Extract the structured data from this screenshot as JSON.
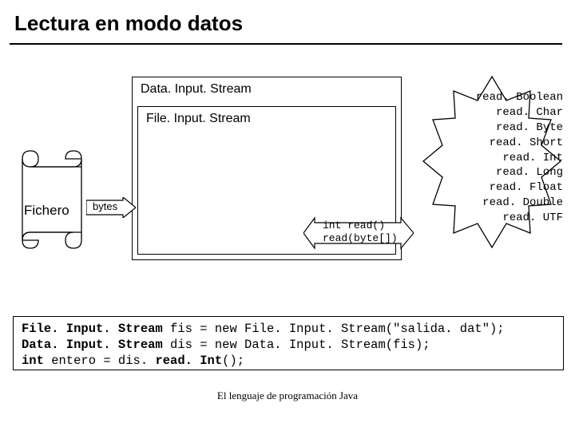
{
  "title": "Lectura en modo datos",
  "diagram": {
    "outer_box_label": "Data. Input. Stream",
    "inner_box_label": "File. Input. Stream",
    "fichero_label": "Fichero",
    "bytes_label": "bytes",
    "read_methods_line1": "int read()",
    "read_methods_line2": "read(byte[])"
  },
  "methods_list": [
    "read. Boolean",
    "read. Char",
    "read. Byte",
    "read. Short",
    "read. Int",
    "read. Long",
    "read. Float",
    "read. Double",
    "read. UTF"
  ],
  "code": {
    "line1_type": "File. Input. Stream",
    "line1_rest": " fis = new File. Input. Stream(\"salida. dat\");",
    "line2_type": "Data. Input. Stream",
    "line2_rest": " dis = new Data. Input. Stream(fis);",
    "line3_type": "int",
    "line3_mid": " entero = dis. ",
    "line3_call": "read. Int",
    "line3_end": "();"
  },
  "footer": "El lenguaje de programación Java"
}
